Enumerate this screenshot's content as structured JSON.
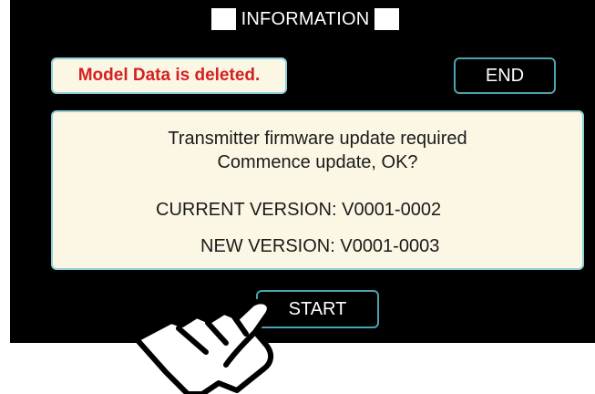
{
  "header": {
    "title": "INFORMATION"
  },
  "status": {
    "message": "Model Data is deleted."
  },
  "buttons": {
    "end_label": "END",
    "start_label": "START"
  },
  "dialog": {
    "line1": "Transmitter firmware update required",
    "line2": "Commence update, OK?",
    "current_version": "CURRENT VERSION: V0001-0002",
    "new_version": "NEW VERSION: V0001-0003"
  },
  "colors": {
    "screen_bg": "#000000",
    "panel_bg": "#fbf7e4",
    "panel_border": "#8fd0d8",
    "button_border": "#4aa3ae",
    "alert_text": "#d42121"
  },
  "icons": {
    "pointer": "pointing-hand-icon"
  }
}
